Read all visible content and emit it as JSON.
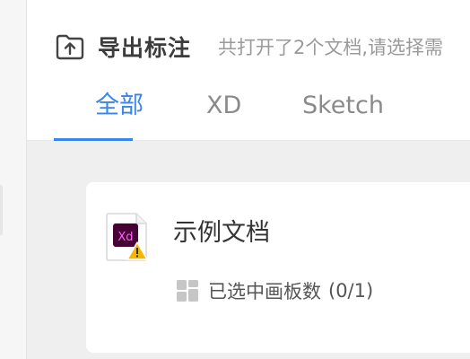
{
  "header": {
    "title": "导出标注",
    "subtitle": "共打开了2个文档,请选择需"
  },
  "tabs": [
    {
      "label": "全部",
      "active": true
    },
    {
      "label": "XD",
      "active": false
    },
    {
      "label": "Sketch",
      "active": false
    }
  ],
  "document": {
    "name": "示例文档",
    "badge_text": "Xd",
    "artboards_label": "已选中画板数",
    "artboards_count": "(0/1)"
  },
  "colors": {
    "accent": "#3a85e8",
    "xd_badge": "#470137",
    "xd_text": "#ff61f6",
    "warning": "#f5b800"
  },
  "icons": {
    "export": "folder-upload-icon",
    "document": "xd-file-icon",
    "warning": "warning-icon",
    "artboard": "artboard-grid-icon"
  }
}
